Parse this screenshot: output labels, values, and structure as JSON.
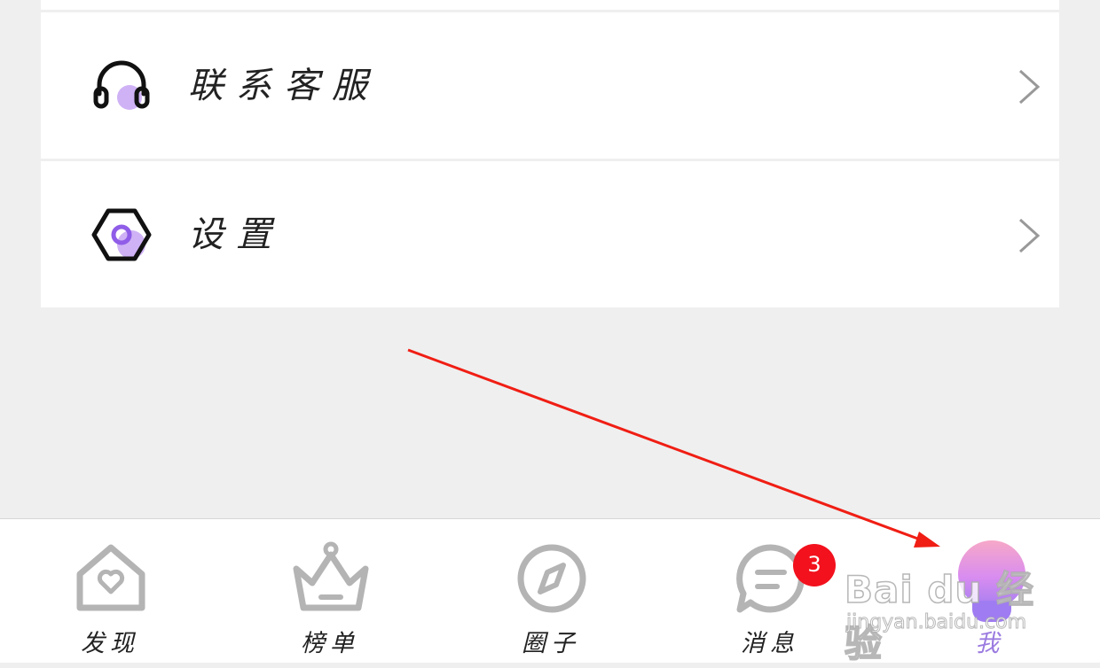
{
  "menu": {
    "items": [
      {
        "label": "联系客服",
        "icon": "headset-icon"
      },
      {
        "label": "设置",
        "icon": "settings-hexagon-icon"
      }
    ]
  },
  "tabbar": {
    "tabs": [
      {
        "label": "发现",
        "icon": "home-heart-icon",
        "active": false
      },
      {
        "label": "榜单",
        "icon": "crown-icon",
        "active": false
      },
      {
        "label": "圈子",
        "icon": "compass-icon",
        "active": false
      },
      {
        "label": "消息",
        "icon": "message-bubble-icon",
        "active": false,
        "badge": "3"
      },
      {
        "label": "我",
        "icon": "avatar-icon",
        "active": true
      }
    ]
  },
  "watermark": {
    "main": "Bai du 经验",
    "sub": "jingyan.baidu.com"
  },
  "colors": {
    "accent": "#9b7be0",
    "badge": "#f2111d",
    "annotation": "#f01e14"
  }
}
